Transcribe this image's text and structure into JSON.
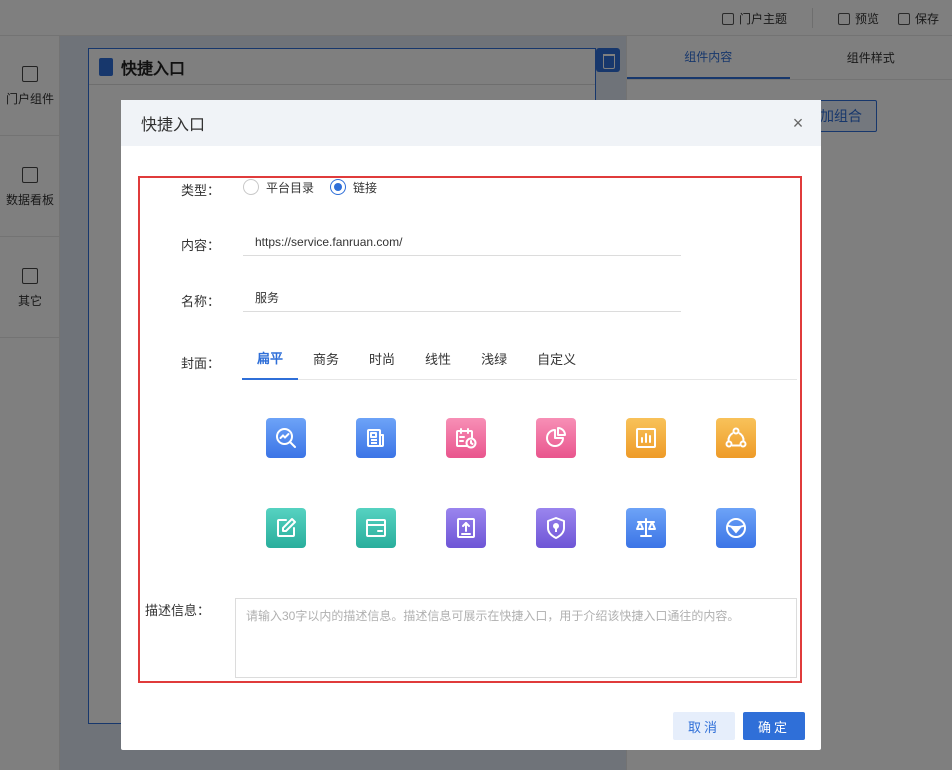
{
  "topbar": {
    "theme_label": "门户主题",
    "preview_label": "预览",
    "save_label": "保存"
  },
  "leftnav": {
    "items": [
      {
        "label": "门户组件",
        "icon": "grid-add-icon"
      },
      {
        "label": "数据看板",
        "icon": "monitor-chart-icon"
      },
      {
        "label": "其它",
        "icon": "document-icon"
      }
    ]
  },
  "canvas": {
    "widget_title": "快捷入口"
  },
  "rightpanel": {
    "tabs": [
      "组件内容",
      "组件样式"
    ],
    "add_group_label": "加组合"
  },
  "dialog": {
    "title": "快捷入口",
    "type_label": "类型：",
    "type_options": [
      "平台目录",
      "链接"
    ],
    "type_selected": "链接",
    "content_label": "内容：",
    "content_value": "https://service.fanruan.com/",
    "name_label": "名称：",
    "name_value": "服务",
    "cover_label": "封面：",
    "cover_tabs": [
      "扁平",
      "商务",
      "时尚",
      "线性",
      "浅绿",
      "自定义"
    ],
    "cover_tab_active": "扁平",
    "cover_icons": [
      {
        "name": "search-chart-icon",
        "color": "#4f86ee"
      },
      {
        "name": "newspaper-icon",
        "color": "#4f86ee"
      },
      {
        "name": "calendar-clock-icon",
        "color": "#ee6b9d"
      },
      {
        "name": "pie-chart-icon",
        "color": "#ee6b9d"
      },
      {
        "name": "bar-chart-icon",
        "color": "#f2ab3c"
      },
      {
        "name": "share-nodes-icon",
        "color": "#f2ab3c"
      },
      {
        "name": "edit-icon",
        "color": "#3cbfae"
      },
      {
        "name": "card-icon",
        "color": "#3cbfae"
      },
      {
        "name": "upload-icon",
        "color": "#8068e0"
      },
      {
        "name": "shield-icon",
        "color": "#8068e0"
      },
      {
        "name": "scale-icon",
        "color": "#4f86ee"
      },
      {
        "name": "steering-wheel-icon",
        "color": "#4f86ee"
      }
    ],
    "desc_label": "描述信息：",
    "desc_placeholder": "请输入30字以内的描述信息。描述信息可展示在快捷入口，用于介绍该快捷入口通往的内容。",
    "cancel_label": "取消",
    "ok_label": "确定"
  },
  "colors": {
    "accent": "#2f6fd8",
    "highlight_border": "#e03b3b"
  }
}
